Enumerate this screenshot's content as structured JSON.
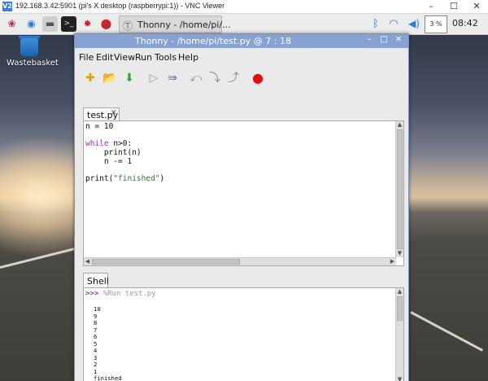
{
  "vnc": {
    "logo": "V2",
    "title": "192.168.3.42:5901 (pi's X desktop (raspberrypi:1)) - VNC Viewer",
    "controls": [
      "–",
      "☐",
      "✕"
    ]
  },
  "taskbar": {
    "launchers": [
      {
        "icon": "raspberry-menu-icon",
        "glyph": "❀",
        "color": "#c51a4a"
      },
      {
        "icon": "globe-browser-icon",
        "glyph": "◉",
        "color": "#2b7bd6"
      },
      {
        "icon": "file-manager-icon",
        "glyph": "▬",
        "color": "#555555"
      },
      {
        "icon": "terminal-icon",
        "glyph": ">_",
        "color": "#222222"
      },
      {
        "icon": "mathematica-icon",
        "glyph": "✸",
        "color": "#d42020"
      },
      {
        "icon": "wolfram-icon",
        "glyph": "⬤",
        "color": "#c62828"
      }
    ],
    "active_task": {
      "icon": "thonny-task-icon",
      "label": "Thonny  -  /home/pi/..."
    },
    "tray": {
      "bluetooth": "ᛒ",
      "wifi": "◠",
      "volume": "🔈",
      "cpu": "3 %",
      "clock": "08:42"
    }
  },
  "desktop": {
    "wastebasket_label": "Wastebasket"
  },
  "thonny": {
    "title": "Thonny  -  /home/pi/test.py  @  7 : 18",
    "window_controls": [
      "–",
      "□",
      "✕"
    ],
    "menu": [
      "File",
      "Edit",
      "View",
      "Run",
      "Tools",
      "Help"
    ],
    "toolbar": [
      {
        "name": "new-file-icon",
        "glyph": "✚",
        "color": "#d9a400"
      },
      {
        "name": "open-file-icon",
        "glyph": "📂",
        "color": "#6b5a3a"
      },
      {
        "name": "save-file-icon",
        "glyph": "⬇",
        "color": "#3aa13a"
      },
      {
        "name": "run-icon",
        "glyph": "▷",
        "color": "#9a9a9a"
      },
      {
        "name": "debug-icon",
        "glyph": "⇛",
        "color": "#5b6db0"
      },
      {
        "name": "step-over-icon",
        "glyph": "⤺",
        "color": "#8a8a8a"
      },
      {
        "name": "step-into-icon",
        "glyph": "⤵",
        "color": "#8a8a8a"
      },
      {
        "name": "step-out-icon",
        "glyph": "⤴",
        "color": "#8a8a8a"
      },
      {
        "name": "stop-icon",
        "glyph": "●",
        "color": "#e01010"
      }
    ],
    "editor_tab": {
      "label": "test.py",
      "close": "✕"
    },
    "code_lines": [
      {
        "text": "n = 10"
      },
      {
        "text": ""
      },
      {
        "kw": "while",
        "text": " n>0:"
      },
      {
        "text": "    print(n)"
      },
      {
        "text": "    n -= 1"
      },
      {
        "text": ""
      },
      {
        "text": "print(",
        "str": "\"finished\"",
        "after": ")"
      }
    ],
    "shell_tab": {
      "label": "Shell"
    },
    "shell": {
      "prompt": ">>>",
      "command": "%Run test.py",
      "output": [
        "10",
        "9",
        "8",
        "7",
        "6",
        "5",
        "4",
        "3",
        "2",
        "1",
        "finished"
      ]
    }
  }
}
